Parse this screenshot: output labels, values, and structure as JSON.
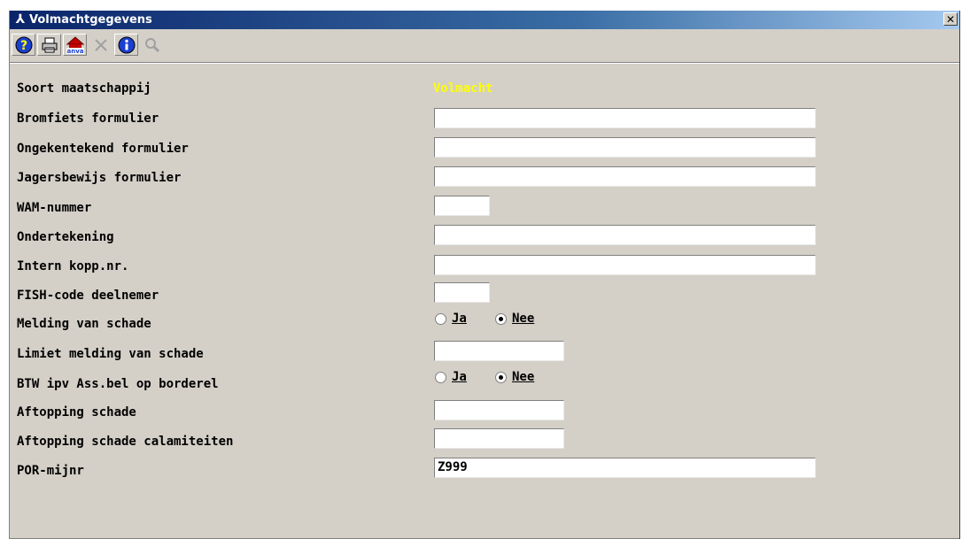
{
  "window": {
    "title": "Volmachtgegevens",
    "close_glyph": "✕"
  },
  "toolbar": {
    "buttons": [
      {
        "name": "help-icon",
        "enabled": true
      },
      {
        "name": "print-icon",
        "enabled": true
      },
      {
        "name": "anva-icon",
        "enabled": true,
        "text": "anva"
      },
      {
        "name": "delete-icon",
        "enabled": false
      },
      {
        "name": "info-icon",
        "enabled": true
      },
      {
        "name": "zoom-icon",
        "enabled": false
      }
    ]
  },
  "form": {
    "soort_maatschappij": {
      "label": "Soort maatschappij",
      "value": "Volmacht"
    },
    "bromfiets": {
      "label": "Bromfiets formulier",
      "value": ""
    },
    "ongekentekend": {
      "label": "Ongekentekend formulier",
      "value": ""
    },
    "jagersbewijs": {
      "label": "Jagersbewijs formulier",
      "value": ""
    },
    "wam_nummer": {
      "label": "WAM-nummer",
      "value": ""
    },
    "ondertekening": {
      "label": "Ondertekening",
      "value": ""
    },
    "intern_kopp": {
      "label": "Intern kopp.nr.",
      "value": ""
    },
    "fish_code": {
      "label": "FISH-code deelnemer",
      "value": ""
    },
    "melding_schade": {
      "label": "Melding van schade",
      "options": [
        "Ja",
        "Nee"
      ],
      "selected": "Nee"
    },
    "limiet_melding": {
      "label": "Limiet melding van schade",
      "value": ""
    },
    "btw": {
      "label": "BTW ipv Ass.bel op borderel",
      "options": [
        "Ja",
        "Nee"
      ],
      "selected": "Nee"
    },
    "aftopping_schade": {
      "label": "Aftopping schade",
      "value": ""
    },
    "aftopping_calamiteiten": {
      "label": "Aftopping schade calamiteiten",
      "value": ""
    },
    "por_mijnr": {
      "label": "POR-mijnr",
      "value": "Z999"
    }
  },
  "colors": {
    "window_bg": "#d4d0c8",
    "title_gradient_start": "#0a246a",
    "title_gradient_end": "#a6caf0",
    "highlight_value": "#ffff00"
  }
}
